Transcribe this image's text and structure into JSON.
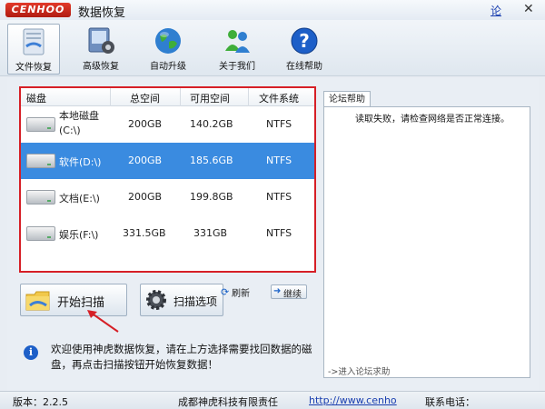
{
  "titlebar": {
    "logo": "CENHOO",
    "title": "数据恢复",
    "link": "论",
    "close": "✕"
  },
  "toolbar": {
    "items": [
      {
        "label": "文件恢复",
        "icon": "file-recover-icon",
        "active": true
      },
      {
        "label": "高级恢复",
        "icon": "advanced-recover-icon"
      },
      {
        "label": "自动升级",
        "icon": "globe-icon"
      },
      {
        "label": "关于我们",
        "icon": "people-icon"
      },
      {
        "label": "在线帮助",
        "icon": "help-icon"
      }
    ]
  },
  "disk_table": {
    "headers": [
      "磁盘",
      "总空间",
      "可用空间",
      "文件系统"
    ],
    "rows": [
      {
        "name_line1": "本地磁盘",
        "name_line2": "(C:\\)",
        "total": "200GB",
        "free": "140.2GB",
        "fs": "NTFS",
        "selected": false
      },
      {
        "name": "软件(D:\\)",
        "total": "200GB",
        "free": "185.6GB",
        "fs": "NTFS",
        "selected": true
      },
      {
        "name": "文档(E:\\)",
        "total": "200GB",
        "free": "199.8GB",
        "fs": "NTFS",
        "selected": false
      },
      {
        "name": "娱乐(F:\\)",
        "total": "331.5GB",
        "free": "331GB",
        "fs": "NTFS",
        "selected": false
      }
    ]
  },
  "buttons": {
    "scan": "开始扫描",
    "options": "扫描选项",
    "refresh": "刷新",
    "continue": "继续"
  },
  "info": {
    "text": "欢迎使用神虎数据恢复，请在上方选择需要找回数据的磁盘，再点击扫描按钮开始恢复数据！"
  },
  "help": {
    "tab": "论坛帮助",
    "message": "读取失败，请检查网络是否正常连接。",
    "link": "->进入论坛求助"
  },
  "status": {
    "version": "版本：2.2.5",
    "company": "成都神虎科技有限责任",
    "url": "http://www.cenho",
    "phone": "联系电话："
  },
  "colors": {
    "accent_red": "#d61f26",
    "selected_row": "#3a8be0",
    "link": "#1a3fb0"
  }
}
